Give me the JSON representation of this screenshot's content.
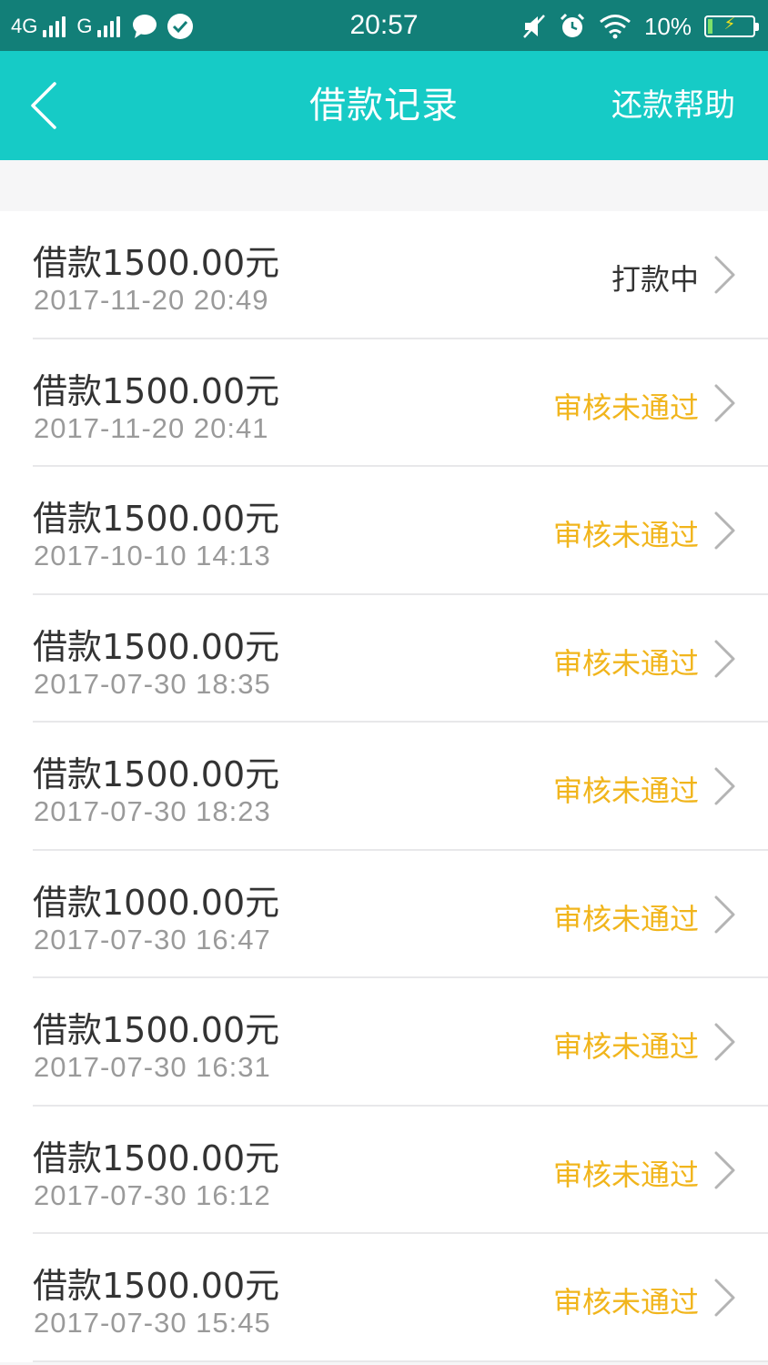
{
  "status_bar": {
    "network_primary": "4G",
    "network_secondary": "G",
    "time": "20:57",
    "battery_percent": "10%",
    "battery_level": 0.1,
    "icons": [
      "signal-4g-icon",
      "signal-g-icon",
      "message-icon",
      "check-circle-icon",
      "mute-icon",
      "alarm-icon",
      "wifi-icon",
      "battery-charging-icon"
    ]
  },
  "nav": {
    "title": "借款记录",
    "help_label": "还款帮助",
    "back_icon": "chevron-left-icon"
  },
  "colors": {
    "status_bar": "#127f78",
    "nav_bar": "#16cbc6",
    "status_pending": "#333333",
    "status_rejected": "#f1b51c"
  },
  "records": [
    {
      "amount": "借款1500.00元",
      "date": "2017-11-20 20:49",
      "status": "打款中",
      "status_color": "#333333"
    },
    {
      "amount": "借款1500.00元",
      "date": "2017-11-20 20:41",
      "status": "审核未通过",
      "status_color": "#f1b51c"
    },
    {
      "amount": "借款1500.00元",
      "date": "2017-10-10 14:13",
      "status": "审核未通过",
      "status_color": "#f1b51c"
    },
    {
      "amount": "借款1500.00元",
      "date": "2017-07-30 18:35",
      "status": "审核未通过",
      "status_color": "#f1b51c"
    },
    {
      "amount": "借款1500.00元",
      "date": "2017-07-30 18:23",
      "status": "审核未通过",
      "status_color": "#f1b51c"
    },
    {
      "amount": "借款1000.00元",
      "date": "2017-07-30 16:47",
      "status": "审核未通过",
      "status_color": "#f1b51c"
    },
    {
      "amount": "借款1500.00元",
      "date": "2017-07-30 16:31",
      "status": "审核未通过",
      "status_color": "#f1b51c"
    },
    {
      "amount": "借款1500.00元",
      "date": "2017-07-30 16:12",
      "status": "审核未通过",
      "status_color": "#f1b51c"
    },
    {
      "amount": "借款1500.00元",
      "date": "2017-07-30 15:45",
      "status": "审核未通过",
      "status_color": "#f1b51c"
    }
  ]
}
